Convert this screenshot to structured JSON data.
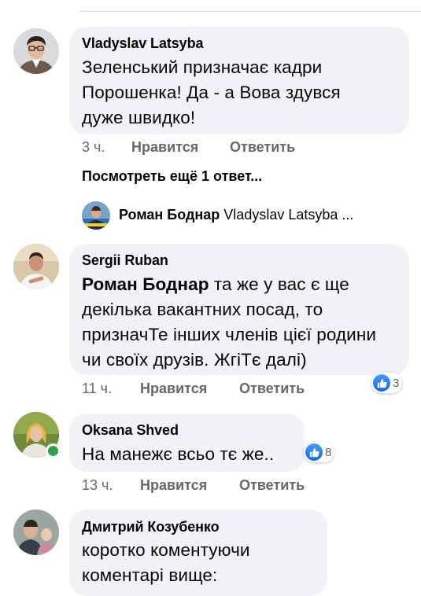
{
  "comments": [
    {
      "author": "Vladyslav Latsyba",
      "text": "Зеленський призначає кадри\nПорошенка! Да - а Вова здувся\nдуже швидко!",
      "time": "3 ч.",
      "like_label": "Нравится",
      "reply_label": "Ответить"
    },
    {
      "author": "Sergii Ruban",
      "mention": "Роман Боднар",
      "text": " та же у вас є ще\nдекілька вакантних посад, то\nпризначТе інших членів цієї родини\nчи своїх друзів. ЖгіТє далі)",
      "time": "11 ч.",
      "like_label": "Нравится",
      "reply_label": "Ответить",
      "reaction_count": "3"
    },
    {
      "author": "Oksana Shved",
      "text": "На манежє всьо тє же..",
      "time": "13 ч.",
      "like_label": "Нравится",
      "reply_label": "Ответить",
      "reaction_count": "8"
    },
    {
      "author": "Дмитрий Козубенко",
      "text": "коротко коментуючи\nкоментарі вище:"
    }
  ],
  "view_more": "Посмотреть ещё 1 ответ...",
  "reply_preview": {
    "name": "Роман Боднар",
    "text": "Vladyslav Latsyba ..."
  },
  "colors": {
    "bubble": "#f0f2f5",
    "meta": "#65676b",
    "like": "#1877f2",
    "online": "#31a24c"
  },
  "icons": [
    "like-icon",
    "avatar"
  ]
}
